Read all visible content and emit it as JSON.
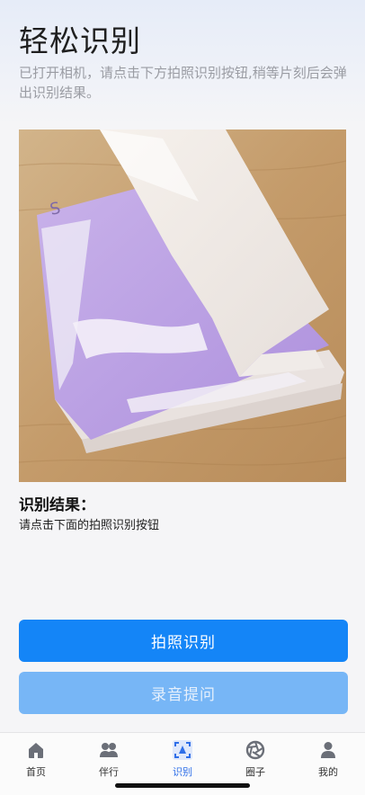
{
  "header": {
    "title": "轻松识别",
    "subtitle": "已打开相机，请点击下方拍照识别按钮,稍等片刻后会弹出识别结果。"
  },
  "result": {
    "title": "识别结果：",
    "text": "请点击下面的拍照识别按钮"
  },
  "buttons": {
    "capture_label": "拍照识别",
    "voice_label": "录音提问"
  },
  "tabbar": {
    "active": "识别",
    "items": [
      {
        "label": "首页",
        "icon": "home-icon"
      },
      {
        "label": "伴行",
        "icon": "companions-icon"
      },
      {
        "label": "识别",
        "icon": "scan-icon"
      },
      {
        "label": "圈子",
        "icon": "aperture-icon"
      },
      {
        "label": "我的",
        "icon": "profile-icon"
      }
    ]
  },
  "colors": {
    "primary": "#1485f7",
    "primary_disabled": "#77b6f6",
    "tab_active": "#2f6fe8"
  }
}
